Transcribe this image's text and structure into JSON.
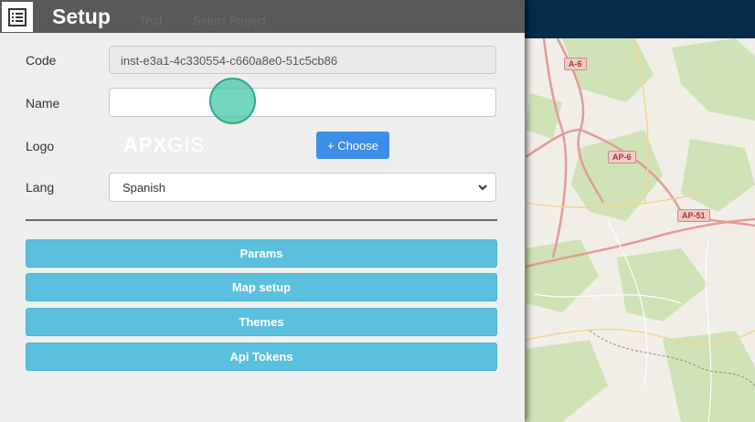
{
  "background_app": {
    "nav_items": [
      "Test",
      "Select Project"
    ]
  },
  "map": {
    "road_labels": [
      "A-6",
      "AP-6",
      "AP-51"
    ]
  },
  "panel": {
    "title": "Setup",
    "menu_icon": "list-icon",
    "fields": {
      "code_label": "Code",
      "code_value": "inst-e3a1-4c330554-c660a8e0-51c5cb86",
      "name_label": "Name",
      "name_value": "",
      "logo_label": "Logo",
      "logo_text_a": "APX",
      "logo_text_b": "GIS",
      "choose_label": "+ Choose",
      "lang_label": "Lang",
      "lang_value": "Spanish"
    },
    "buttons": [
      "Params",
      "Map setup",
      "Themes",
      "Api Tokens"
    ]
  },
  "colors": {
    "header": "#595959",
    "topbar": "#042b4a",
    "primary": "#3d8ee6",
    "info": "#5bc0de",
    "touch": "#48c7aa"
  }
}
